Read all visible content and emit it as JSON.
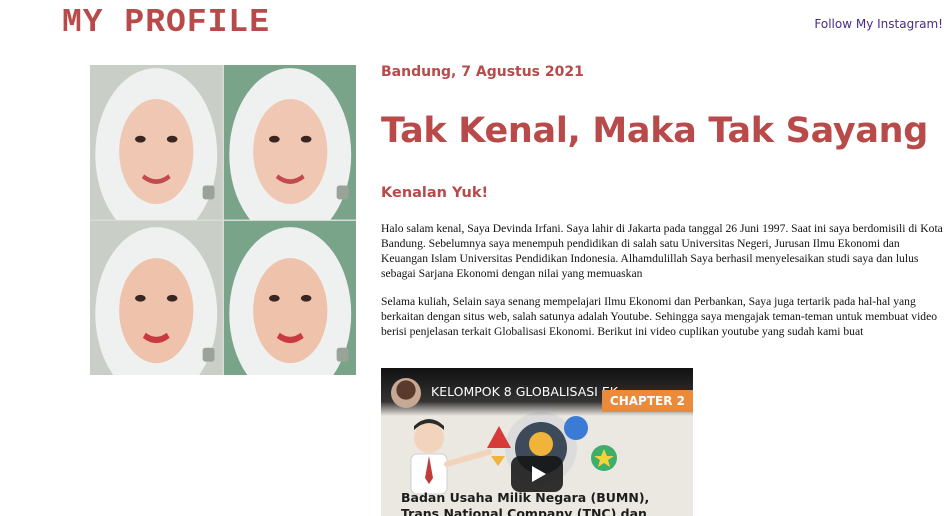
{
  "header": {
    "site_title": "MY PROFILE",
    "instagram_link": "Follow My Instagram!"
  },
  "profile": {
    "photo_count": 4
  },
  "post": {
    "date": "Bandung, 7 Agustus 2021",
    "title": "Tak Kenal, Maka Tak Sayang",
    "subtitle": "Kenalan Yuk!",
    "paragraph_1": "Halo salam kenal, Saya Devinda Irfani. Saya lahir di Jakarta pada tanggal 26 Juni 1997. Saat ini saya berdomisili di Kota Bandung. Sebelumnya saya menempuh pendidikan di salah satu Universitas Negeri, Jurusan Ilmu Ekonomi dan Keuangan Islam Universitas Pendidikan Indonesia. Alhamdulillah Saya berhasil menyelesaikan studi saya dan lulus sebagai Sarjana Ekonomi dengan nilai yang memuaskan",
    "paragraph_2": "Selama kuliah, Selain saya senang mempelajari Ilmu Ekonomi dan Perbankan, Saya juga tertarik pada hal-hal yang berkaitan dengan situs web, salah satunya adalah Youtube. Sehingga saya mengajak teman-teman untuk membuat video berisi penjelasan terkait Globalisasi Ekonomi. Berikut ini video cuplikan youtube yang sudah kami buat"
  },
  "video": {
    "title": "KELOMPOK 8 GLOBALISASI EK...",
    "chapter_badge": "CHAPTER 2",
    "caption": "Badan Usaha Milik Negara (BUMN), Trans National Company (TNC) dan Konglomerasi"
  },
  "colors": {
    "accent": "#b84a4a",
    "link": "#4b2a8a"
  }
}
